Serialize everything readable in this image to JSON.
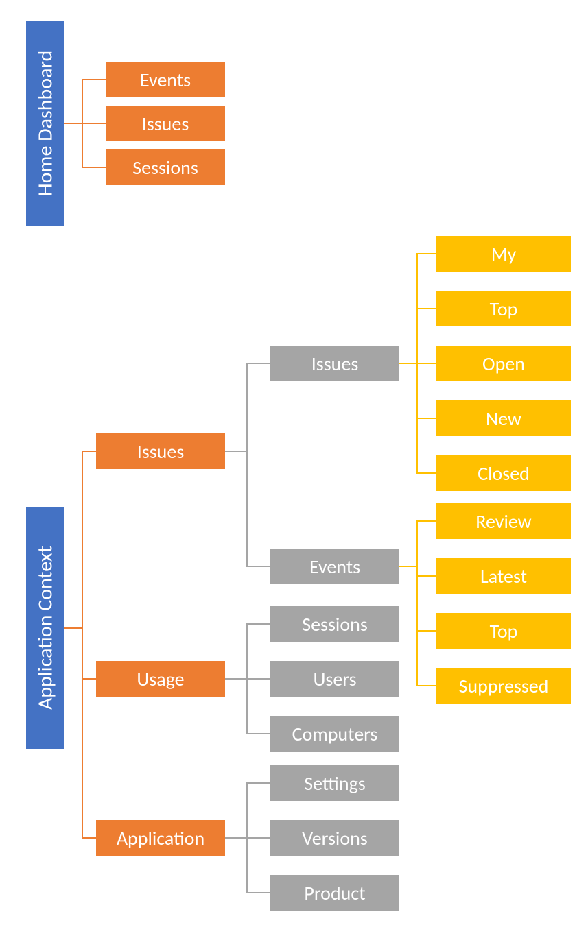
{
  "colors": {
    "blue": "#4472C4",
    "orange": "#ED7D31",
    "gray": "#A5A5A5",
    "gold": "#FFC000"
  },
  "roots": {
    "home_dashboard": "Home Dashboard",
    "application_context": "Application Context"
  },
  "home_children": {
    "events": "Events",
    "issues": "Issues",
    "sessions": "Sessions"
  },
  "app_children": {
    "issues": "Issues",
    "usage": "Usage",
    "application": "Application"
  },
  "issues_children": {
    "issues": "Issues",
    "events": "Events"
  },
  "usage_children": {
    "sessions": "Sessions",
    "users": "Users",
    "computers": "Computers"
  },
  "application_children": {
    "settings": "Settings",
    "versions": "Versions",
    "product": "Product"
  },
  "issues_issues_children": {
    "my": "My",
    "top": "Top",
    "open": "Open",
    "new": "New",
    "closed": "Closed"
  },
  "issues_events_children": {
    "review": "Review",
    "latest": "Latest",
    "top": "Top",
    "suppressed": "Suppressed"
  }
}
